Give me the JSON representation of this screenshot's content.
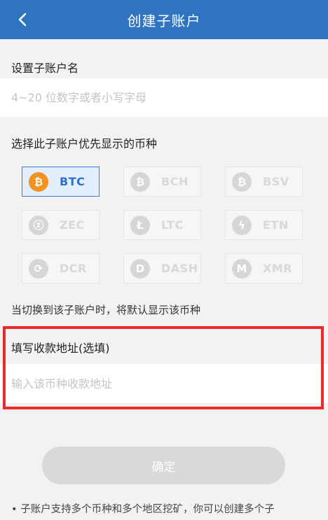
{
  "header": {
    "title": "创建子账户"
  },
  "name_section": {
    "label": "设置子账户名",
    "placeholder": "4~20 位数字或者小写字母"
  },
  "coin_section": {
    "label": "选择此子账户优先显示的币种",
    "note": "当切换到该子账户时，将默认显示该币种",
    "coins": [
      {
        "label": "BTC",
        "glyph": "₿",
        "selected": true
      },
      {
        "label": "BCH",
        "glyph": "₿",
        "selected": false
      },
      {
        "label": "BSV",
        "glyph": "₿",
        "selected": false
      },
      {
        "label": "ZEC",
        "glyph": "ⓩ",
        "selected": false
      },
      {
        "label": "LTC",
        "glyph": "Ł",
        "selected": false
      },
      {
        "label": "ETN",
        "glyph": "ϟ",
        "selected": false
      },
      {
        "label": "DCR",
        "glyph": "⟳",
        "selected": false
      },
      {
        "label": "DASH",
        "glyph": "D",
        "selected": false
      },
      {
        "label": "XMR",
        "glyph": "M",
        "selected": false
      }
    ]
  },
  "address_section": {
    "label": "填写收款地址(选填)",
    "placeholder": "输入该币种收款地址"
  },
  "confirm_label": "确定",
  "footnote": "• 子账户支持多个币种和多个地区挖矿，你可以创建多个子"
}
